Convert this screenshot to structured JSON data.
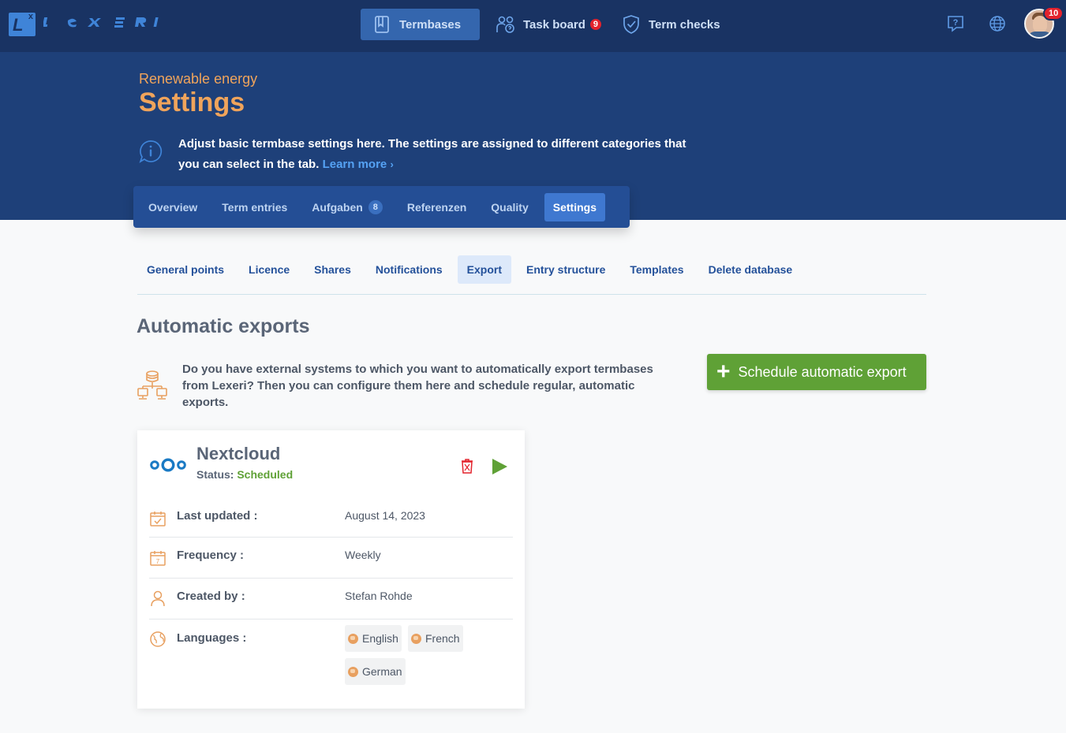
{
  "app": {
    "logo_text": "LEXERI"
  },
  "topnav": {
    "termbases": "Termbases",
    "task_board": "Task board",
    "task_board_count": "9",
    "term_checks": "Term checks",
    "notification_count": "10"
  },
  "hero": {
    "subtitle": "Renewable energy",
    "title": "Settings",
    "info_text": "Adjust basic termbase settings here. The settings are assigned to different categories that you can select in the tab.",
    "learn_more": "Learn more"
  },
  "main_tabs": [
    {
      "label": "Overview"
    },
    {
      "label": "Term entries"
    },
    {
      "label": "Aufgaben",
      "badge": "8"
    },
    {
      "label": "Referenzen"
    },
    {
      "label": "Quality"
    },
    {
      "label": "Settings",
      "active": true
    }
  ],
  "sub_tabs": [
    {
      "label": "General points"
    },
    {
      "label": "Licence"
    },
    {
      "label": "Shares"
    },
    {
      "label": "Notifications"
    },
    {
      "label": "Export",
      "active": true
    },
    {
      "label": "Entry structure"
    },
    {
      "label": "Templates"
    },
    {
      "label": "Delete database"
    }
  ],
  "section": {
    "title": "Automatic exports",
    "description": "Do you have external systems to which you want to automatically export termbases from Lexeri? Then you can configure them here and schedule regular, automatic exports.",
    "schedule_button": "Schedule automatic export"
  },
  "export_card": {
    "name": "Nextcloud",
    "status_label": "Status:",
    "status_value": "Scheduled",
    "last_updated_label": "Last updated :",
    "last_updated_value": "August 14, 2023",
    "frequency_label": "Frequency :",
    "frequency_value": "Weekly",
    "created_by_label": "Created by :",
    "created_by_value": "Stefan Rohde",
    "languages_label": "Languages :",
    "languages": [
      "English",
      "French",
      "German"
    ]
  },
  "colors": {
    "topbar": "#193363",
    "hero": "#1e4079",
    "accent_orange": "#f0a45b",
    "link_blue": "#55a2f4",
    "success_green": "#5fa136",
    "danger_red": "#e3222c"
  }
}
